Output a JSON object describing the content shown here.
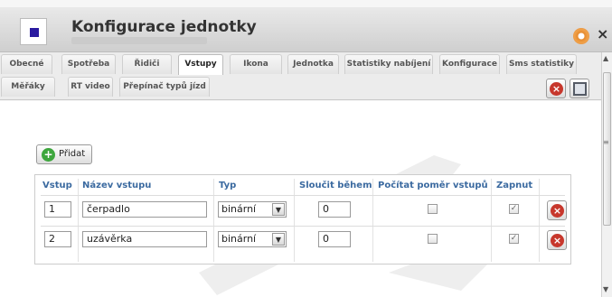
{
  "window": {
    "title": "Konfigurace jednotky",
    "close_label": "×"
  },
  "tabs": [
    {
      "label": "Obecné"
    },
    {
      "label": "Spotřeba"
    },
    {
      "label": "Řidiči"
    },
    {
      "label": "Vstupy",
      "active": true
    },
    {
      "label": "Ikona"
    },
    {
      "label": "Jednotka"
    },
    {
      "label": "Statistiky nabíjení"
    },
    {
      "label": "Konfigurace"
    },
    {
      "label": "Sms statistiky"
    },
    {
      "label": "Měřáky"
    },
    {
      "label": "RT video"
    },
    {
      "label": "Přepínač typů jízd"
    }
  ],
  "toolbar": {
    "add_label": "Přidat"
  },
  "table": {
    "headers": [
      "Vstup",
      "Název vstupu",
      "Typ",
      "Sloučit během",
      "Počítat poměr vstupů",
      "Zapnut"
    ],
    "rows": [
      {
        "vstup": "1",
        "nazev": "čerpadlo",
        "typ": "binární",
        "sloucit": "0",
        "pocitat_pomer": false,
        "zapnut": true
      },
      {
        "vstup": "2",
        "nazev": "uzávěrka",
        "typ": "binární",
        "sloucit": "0",
        "pocitat_pomer": false,
        "zapnut": true
      }
    ]
  },
  "icons": {
    "app": "app-icon",
    "settings": "settings-icon",
    "close_tab": "close-circle-icon",
    "save": "save-icon",
    "add": "add-icon",
    "delete": "delete-icon",
    "dropdown": "chevron-down-icon",
    "check": "check-icon",
    "background": "wrench-watermark"
  },
  "colors": {
    "header_text": "#3b6aa0",
    "delete_red": "#c7372c",
    "add_green": "#3da63d",
    "app_icon": "#2a1aa0"
  }
}
